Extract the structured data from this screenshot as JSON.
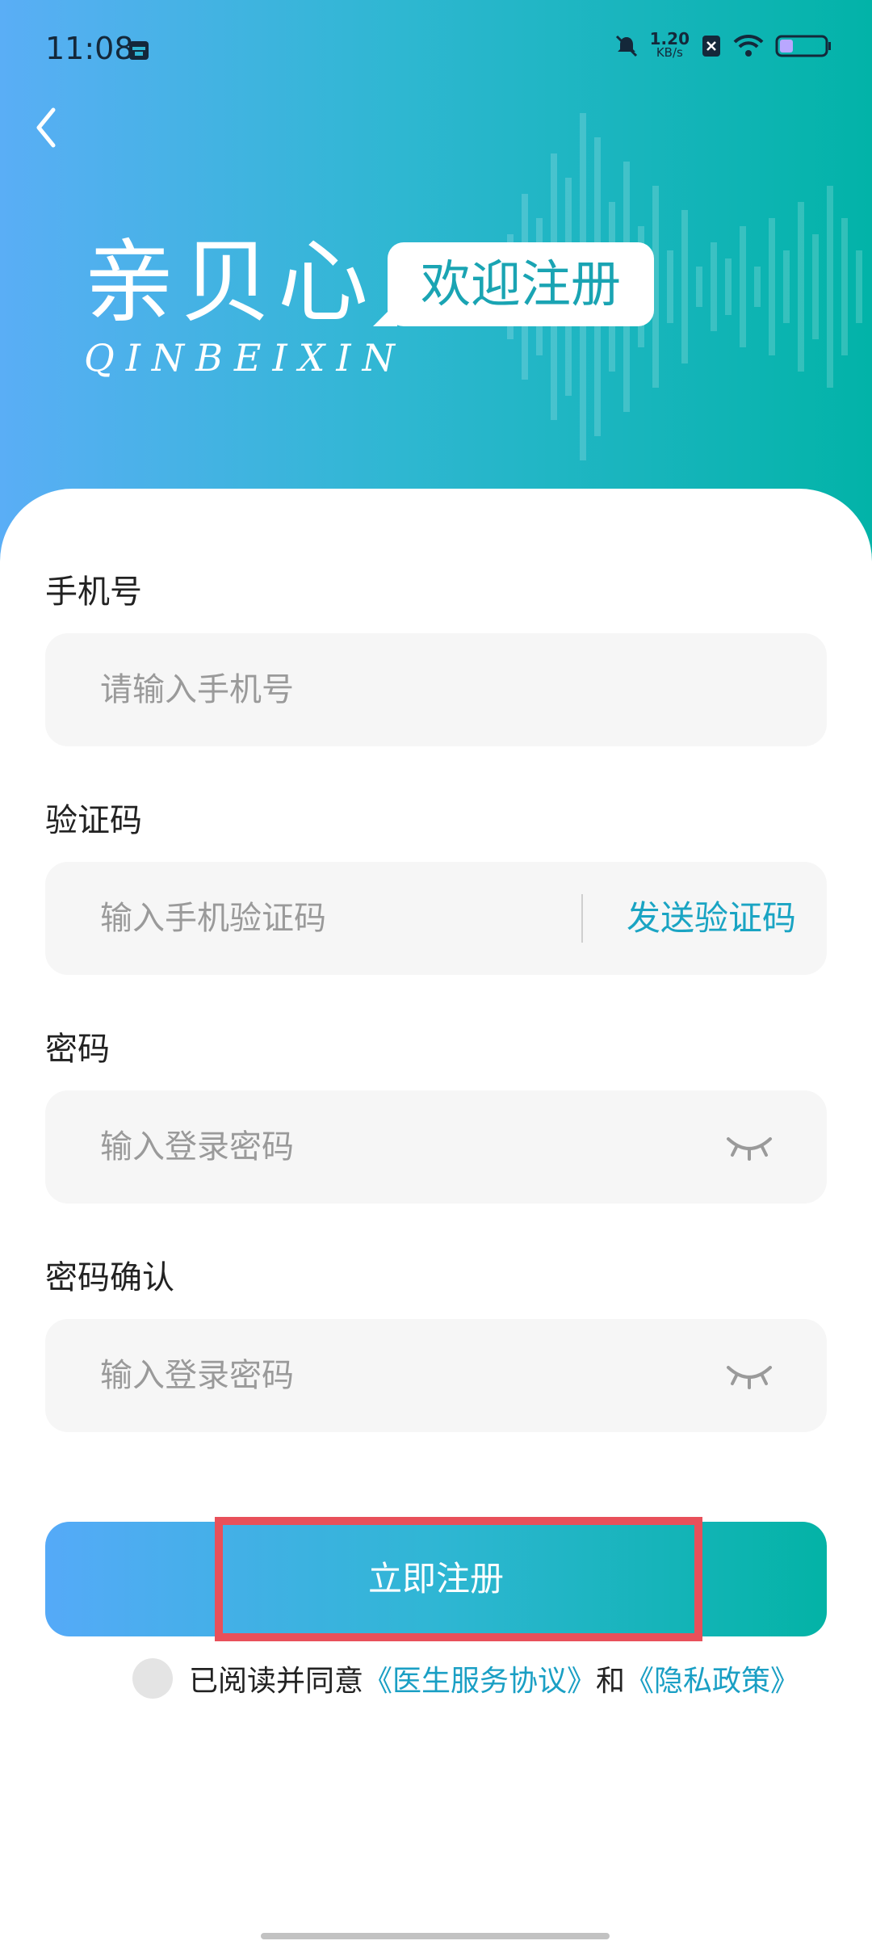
{
  "status": {
    "time": "11:08",
    "net_speed": "1.20",
    "net_unit": "KB/s"
  },
  "header": {
    "back_icon": "chevron-left-icon",
    "logo_cn": "亲贝心",
    "logo_en": "QINBEIXIN",
    "welcome": "欢迎注册"
  },
  "form": {
    "phone_label": "手机号",
    "phone_placeholder": "请输入手机号",
    "code_label": "验证码",
    "code_placeholder": "输入手机验证码",
    "send_code": "发送验证码",
    "password_label": "密码",
    "password_placeholder": "输入登录密码",
    "confirm_label": "密码确认",
    "confirm_placeholder": "输入登录密码",
    "eye_icon": "eye-closed-icon"
  },
  "actions": {
    "register": "立即注册"
  },
  "agreement": {
    "prefix": "已阅读并同意",
    "doctor_terms": "《医生服务协议》",
    "and": "和",
    "privacy": "《隐私政策》"
  },
  "colors": {
    "accent": "#1aa4c3",
    "gradient_start": "#55aaf8",
    "gradient_end": "#03b3a6",
    "highlight": "#e8505a"
  }
}
